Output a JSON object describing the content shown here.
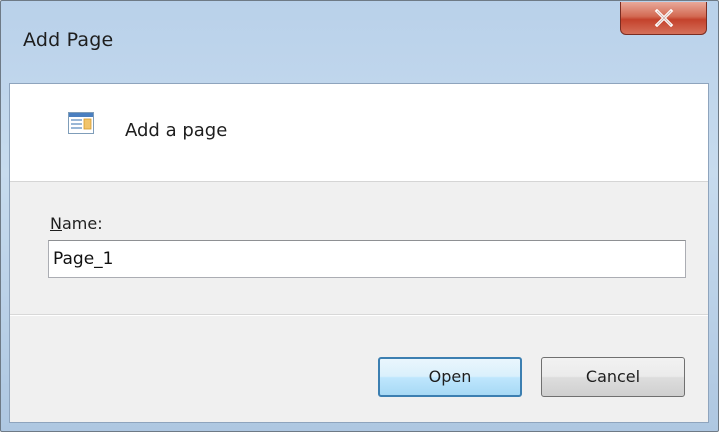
{
  "window": {
    "title": "Add Page",
    "close_icon": "close-icon"
  },
  "header": {
    "icon": "page-icon",
    "text": "Add a page"
  },
  "form": {
    "name_label_accel": "N",
    "name_label_rest": "ame:",
    "name_value": "Page_1"
  },
  "buttons": {
    "open_label": "Open",
    "cancel_label": "Cancel"
  },
  "colors": {
    "frame": "#b9d1ea",
    "close_button": "#c4422c",
    "default_button_border": "#3c7fb1"
  }
}
